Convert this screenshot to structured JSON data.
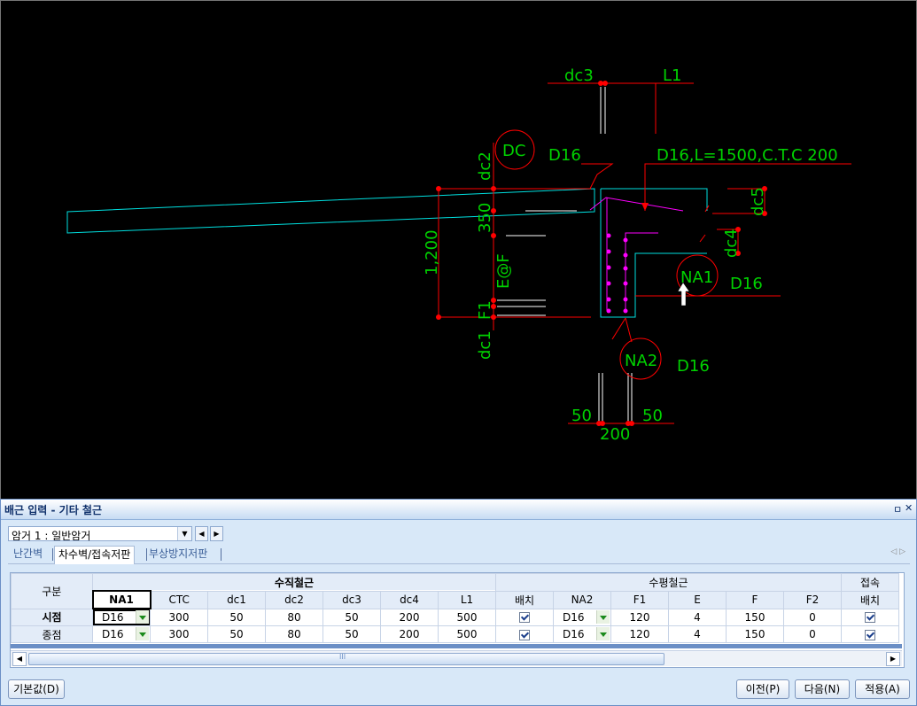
{
  "cad": {
    "labels": {
      "dc3": "dc3",
      "l1": "L1",
      "dc": "DC",
      "d16_dc": "D16",
      "d16_long": "D16,L=1500,C.T.C 200",
      "dc2": "dc2",
      "dc5": "dc5",
      "n350": "350",
      "n1200": "1,200",
      "ef": "E@F",
      "dc4": "dc4",
      "na1": "NA1",
      "d16_na1": "D16",
      "f1": "F1",
      "dc1": "dc1",
      "na2": "NA2",
      "d16_na2": "D16",
      "n50a": "50",
      "n50b": "50",
      "n200": "200"
    }
  },
  "panel": {
    "title": "배근 입력 - 기타 철근",
    "pin": "ㅁ",
    "close": "✕",
    "anchor_select": "암거 1 : 일반암거",
    "tabs": [
      "난간벽",
      "차수벽/접속저판",
      "부상방지저판"
    ],
    "tab_scroll": "◁ ▷",
    "grid": {
      "group_headers": {
        "gubun": "구분",
        "vertical": "수직철근",
        "horizontal": "수평철근",
        "connection": "접속"
      },
      "columns": [
        "NA1",
        "CTC",
        "dc1",
        "dc2",
        "dc3",
        "dc4",
        "L1",
        "배치",
        "NA2",
        "F1",
        "E",
        "F",
        "F2",
        "배치"
      ],
      "rows": [
        {
          "label": "시점",
          "na1": "D16",
          "ctc": "300",
          "dc1": "50",
          "dc2": "80",
          "dc3": "50",
          "dc4": "200",
          "l1": "500",
          "na2": "D16",
          "f1": "120",
          "e": "4",
          "f": "150",
          "f2": "0"
        },
        {
          "label": "종점",
          "na1": "D16",
          "ctc": "300",
          "dc1": "50",
          "dc2": "80",
          "dc3": "50",
          "dc4": "200",
          "l1": "500",
          "na2": "D16",
          "f1": "120",
          "e": "4",
          "f": "150",
          "f2": "0"
        }
      ],
      "scroll_grip": "III"
    },
    "buttons": {
      "default": "기본값(D)",
      "prev": "이전(P)",
      "next": "다음(N)",
      "apply": "적용(A)"
    }
  }
}
